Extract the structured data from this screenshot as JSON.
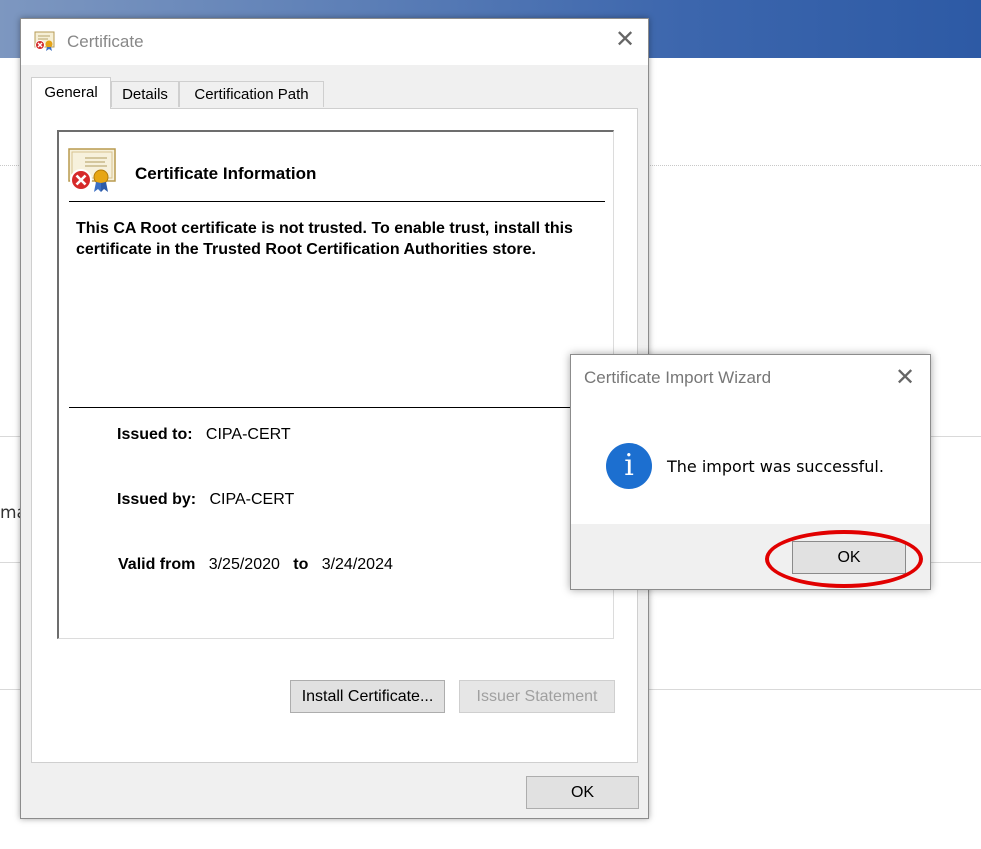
{
  "certificate_window": {
    "title": "Certificate",
    "close_glyph": "✕",
    "tabs": [
      {
        "label": "General",
        "active": true
      },
      {
        "label": "Details",
        "active": false
      },
      {
        "label": "Certification Path",
        "active": false
      }
    ],
    "info_title": "Certificate Information",
    "warning_text": "This CA Root certificate is not trusted. To enable trust, install this certificate in the Trusted Root Certification Authorities store.",
    "issued_to_label": "Issued to:",
    "issued_to_value": "CIPA-CERT",
    "issued_by_label": "Issued by:",
    "issued_by_value": "CIPA-CERT",
    "valid_from_label": "Valid from",
    "valid_from_value": "3/25/2020",
    "valid_to_label": "to",
    "valid_to_value": "3/24/2024",
    "install_button": "Install Certificate...",
    "issuer_statement_button": "Issuer Statement",
    "ok_button": "OK"
  },
  "import_wizard": {
    "title": "Certificate Import Wizard",
    "close_glyph": "✕",
    "icon_glyph": "i",
    "message": "The import was successful.",
    "ok_button": "OK"
  },
  "background": {
    "partial_text": "ma"
  },
  "colors": {
    "highlight": "#e10000",
    "info_icon": "#1c6fd0",
    "header_blue": "#3c66ad"
  },
  "icons": [
    "certificate-icon",
    "close-icon",
    "info-icon"
  ]
}
